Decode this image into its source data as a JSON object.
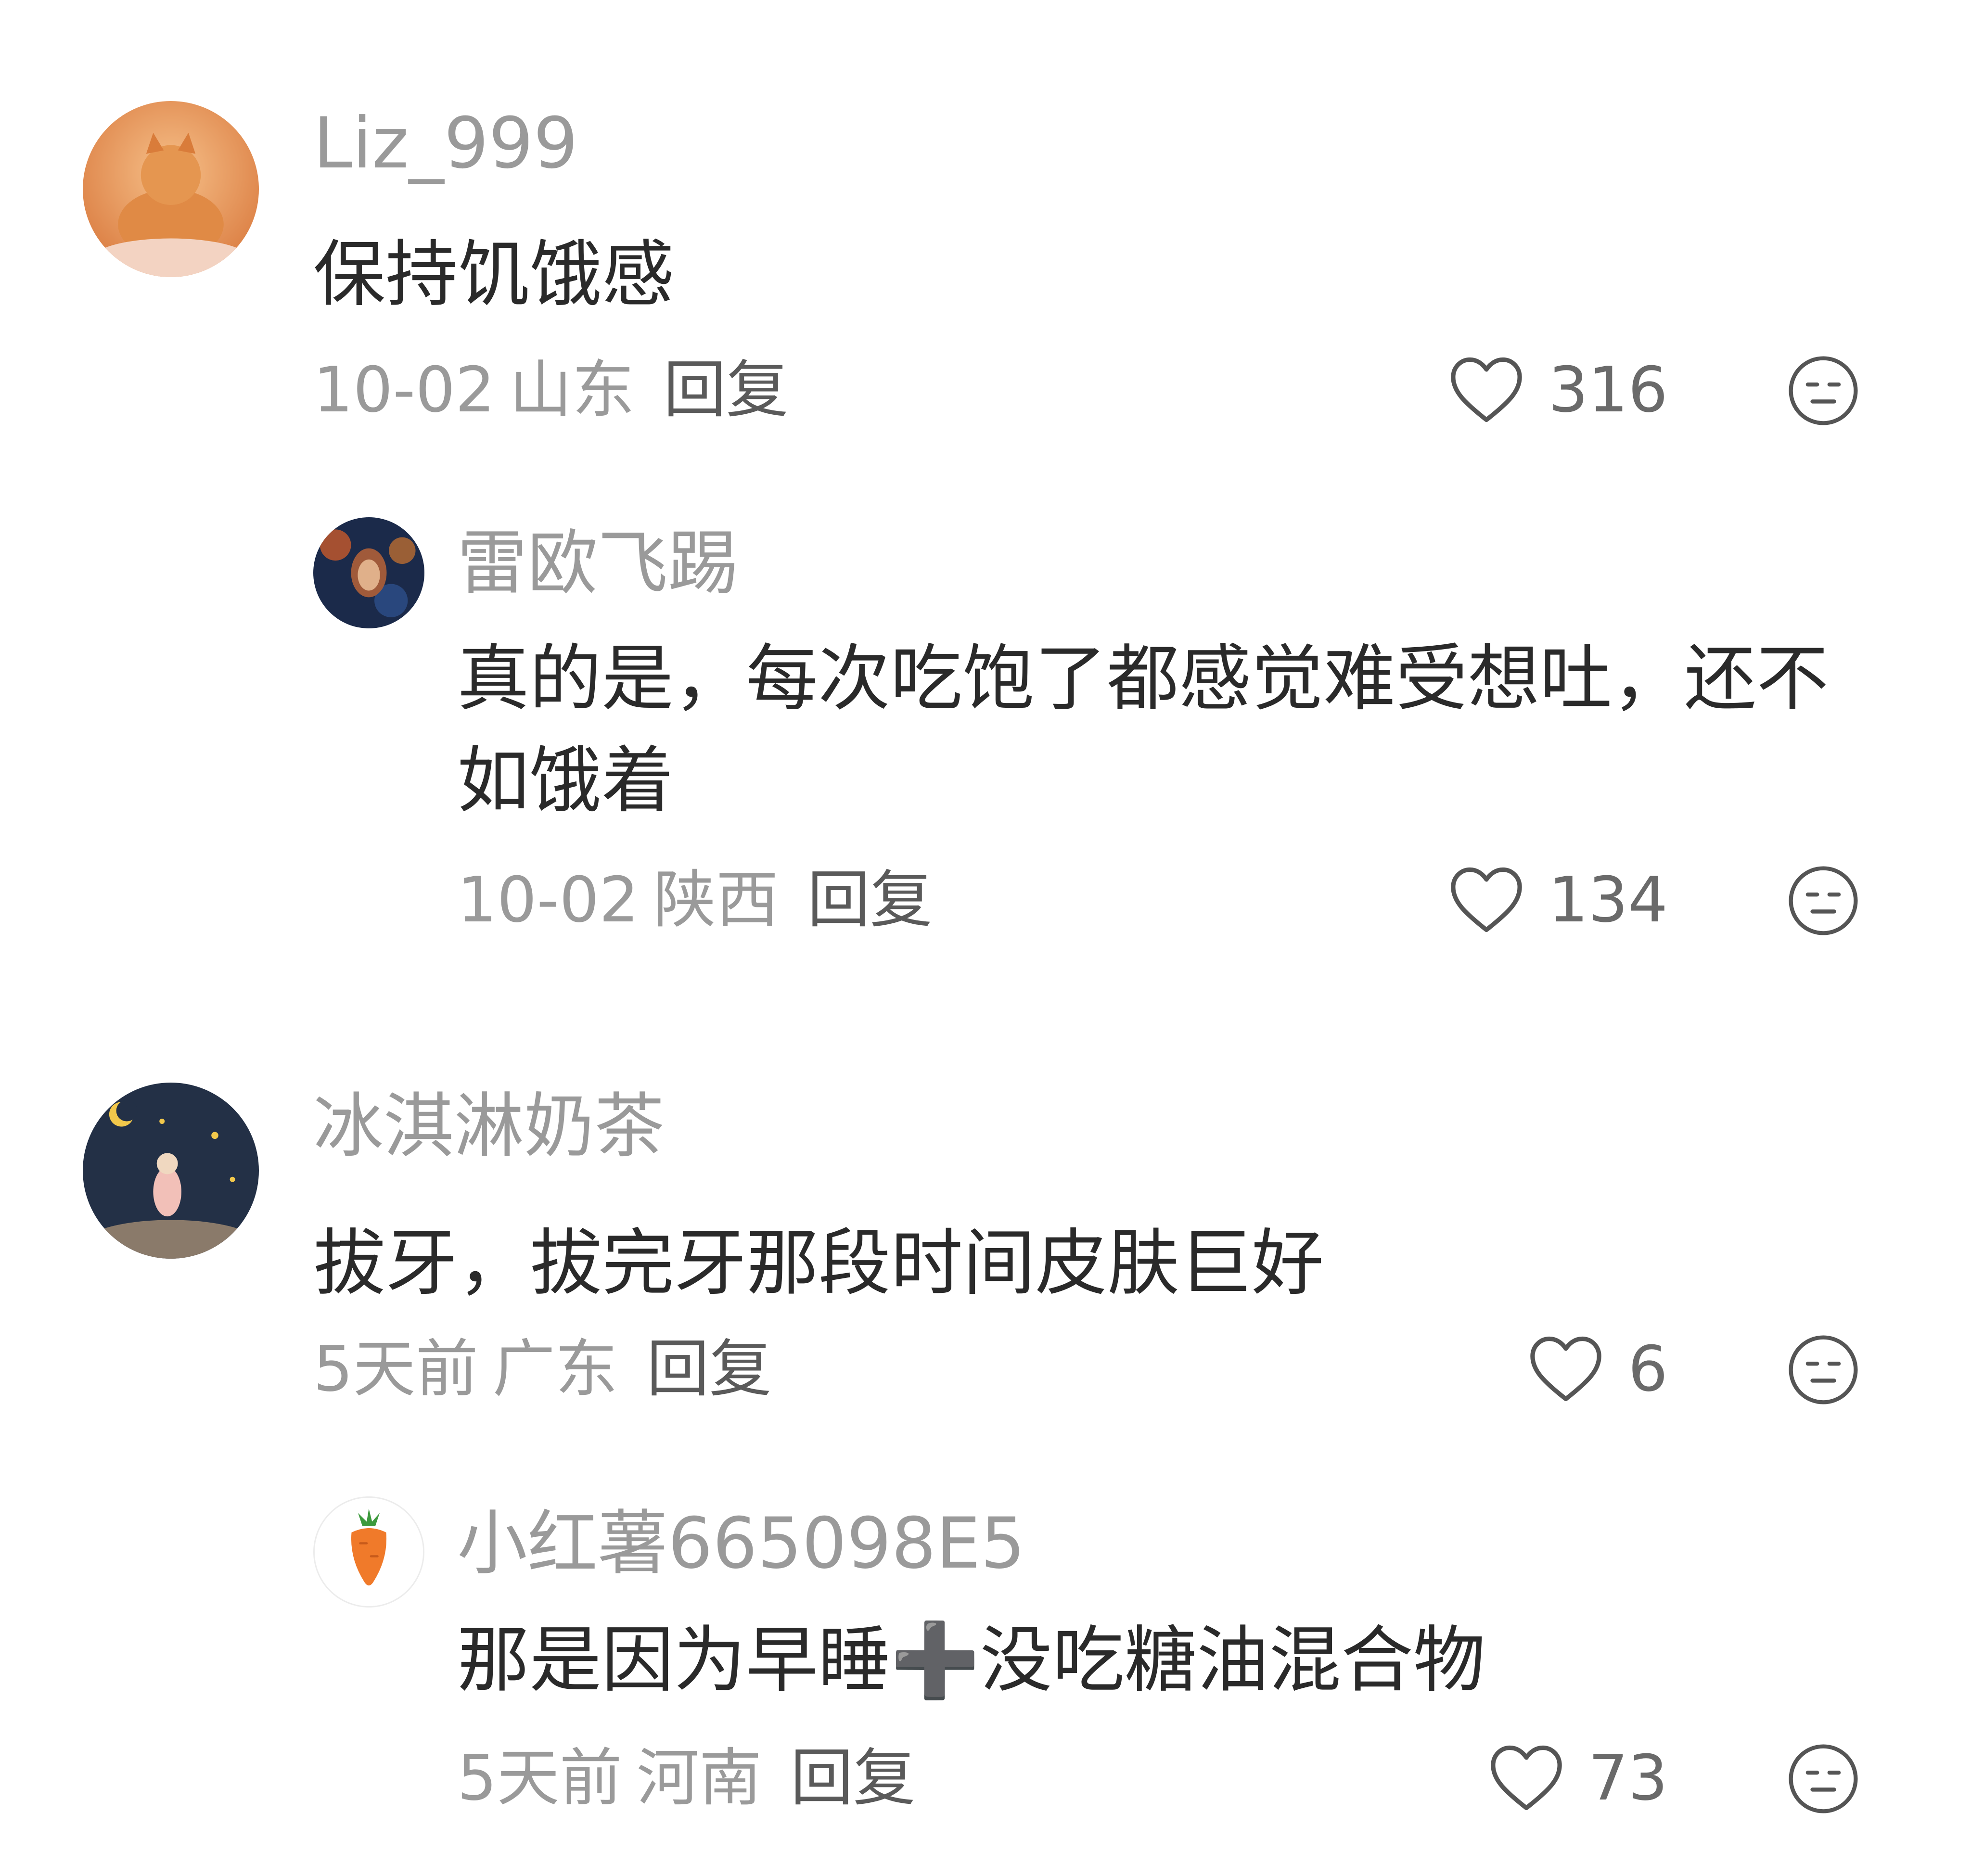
{
  "comments": [
    {
      "username": "Liz_999",
      "text": "保持饥饿感",
      "date": "10-02",
      "region": "山东",
      "reply_label": "回复",
      "likes": "316",
      "avatar_icon": "orange-cat-avatar",
      "replies": [
        {
          "username": "雷欧飞踢",
          "text": "真的是，每次吃饱了都感觉难受想吐，还不如饿着",
          "date": "10-02",
          "region": "陕西",
          "reply_label": "回复",
          "likes": "134",
          "avatar_icon": "dark-portrait-avatar"
        }
      ]
    },
    {
      "username": "冰淇淋奶茶",
      "text": "拔牙，拔完牙那段时间皮肤巨好",
      "date": "5天前",
      "region": "广东",
      "reply_label": "回复",
      "likes": "6",
      "avatar_icon": "night-sky-girl-avatar",
      "replies": [
        {
          "username": "小红薯665098E5",
          "text": "那是因为早睡➕没吃糖油混合物",
          "date": "5天前",
          "region": "河南",
          "reply_label": "回复",
          "likes": "73",
          "avatar_icon": "carrot-avatar"
        }
      ]
    }
  ],
  "icons": {
    "like": "heart-outline-icon",
    "dislike": "meh-face-icon"
  },
  "colors": {
    "username": "#9a9a9a",
    "text": "#2a2a2a",
    "meta": "#9a9a9a",
    "reply": "#5a5a5a"
  }
}
